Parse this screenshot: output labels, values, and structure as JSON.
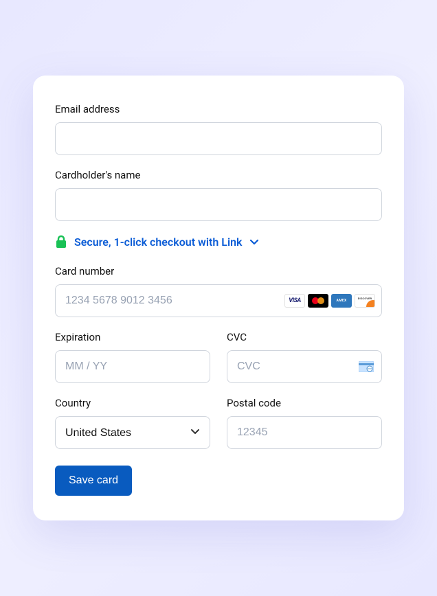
{
  "form": {
    "email": {
      "label": "Email address",
      "value": ""
    },
    "cardholder": {
      "label": "Cardholder's name",
      "value": ""
    },
    "secure_banner": {
      "text": "Secure, 1-click checkout with Link"
    },
    "card_number": {
      "label": "Card number",
      "placeholder": "1234 5678 9012 3456",
      "value": ""
    },
    "expiration": {
      "label": "Expiration",
      "placeholder": "MM / YY",
      "value": ""
    },
    "cvc": {
      "label": "CVC",
      "placeholder": "CVC",
      "value": ""
    },
    "country": {
      "label": "Country",
      "selected": "United States"
    },
    "postal": {
      "label": "Postal code",
      "placeholder": "12345",
      "value": ""
    },
    "submit_label": "Save card",
    "brands": {
      "visa": "VISA",
      "amex": "AMEX",
      "discover": "DISCOVER"
    }
  }
}
